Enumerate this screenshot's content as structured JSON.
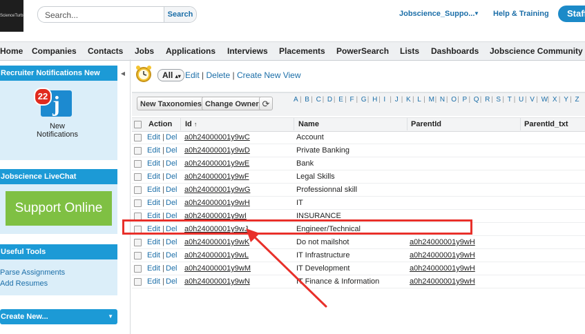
{
  "header": {
    "logo_text": "ScienceTurbines",
    "search_placeholder": "Search...",
    "search_button": "Search",
    "user_menu": "Jobscience_Suppo...",
    "user_caret": "▼",
    "help": "Help & Training",
    "app_button": "Staff"
  },
  "nav": [
    "Home",
    "Companies",
    "Contacts",
    "Jobs",
    "Applications",
    "Interviews",
    "Placements",
    "PowerSearch",
    "Lists",
    "Dashboards",
    "Jobscience Community"
  ],
  "sidebar": {
    "collapse": "◀",
    "notifications": {
      "title": "Recruiter Notifications New",
      "badge": "22",
      "icon_letter": "j",
      "label_1": "New",
      "label_2": "Notifications"
    },
    "livechat": {
      "title": "Jobscience LiveChat",
      "button": "Support Online"
    },
    "tools": {
      "title": "Useful Tools",
      "links": [
        "Parse Assignments",
        "Add Resumes"
      ]
    },
    "create_new": {
      "title": "Create New...",
      "caret": "▼"
    }
  },
  "view": {
    "selected": "All",
    "selector_arrows": "▴▾",
    "edit": "Edit",
    "delete": "Delete",
    "create": "Create New View",
    "sep": "|"
  },
  "toolbar": {
    "new_button": "New Taxonomies",
    "change_owner": "Change Owner",
    "refresh_glyph": "⟳",
    "alphabet": [
      "A",
      "B",
      "C",
      "D",
      "E",
      "F",
      "G",
      "H",
      "I",
      "J",
      "K",
      "L",
      "M",
      "N",
      "O",
      "P",
      "Q",
      "R",
      "S",
      "T",
      "U",
      "V",
      "W",
      "X",
      "Y",
      "Z"
    ]
  },
  "table": {
    "columns": [
      "Action",
      "Id",
      "Name",
      "ParentId",
      "ParentId_txt"
    ],
    "sort_indicator": "↑",
    "action_edit": "Edit",
    "action_sep": "|",
    "action_del": "Del",
    "rows": [
      {
        "id": "a0h24000001y9wC",
        "name": "Account",
        "parent": ""
      },
      {
        "id": "a0h24000001y9wD",
        "name": "Private Banking",
        "parent": ""
      },
      {
        "id": "a0h24000001y9wE",
        "name": "Bank",
        "parent": ""
      },
      {
        "id": "a0h24000001y9wF",
        "name": "Legal Skills",
        "parent": ""
      },
      {
        "id": "a0h24000001y9wG",
        "name": "Professionnal skill",
        "parent": ""
      },
      {
        "id": "a0h24000001y9wH",
        "name": "IT",
        "parent": ""
      },
      {
        "id": "a0h24000001y9wI",
        "name": "INSURANCE",
        "parent": ""
      },
      {
        "id": "a0h24000001y9wJ",
        "name": "Engineer/Technical",
        "parent": ""
      },
      {
        "id": "a0h24000001y9wK",
        "name": "Do not mailshot",
        "parent": "a0h24000001y9wH"
      },
      {
        "id": "a0h24000001y9wL",
        "name": "IT Infrastructure",
        "parent": "a0h24000001y9wH"
      },
      {
        "id": "a0h24000001y9wM",
        "name": "IT Development",
        "parent": "a0h24000001y9wH"
      },
      {
        "id": "a0h24000001y9wN",
        "name": "IT Finance & Information",
        "parent": "a0h24000001y9wH"
      }
    ]
  },
  "colors": {
    "highlight": "#e8302a",
    "header_blue": "#1c9ad6",
    "link": "#1b6ea8"
  }
}
